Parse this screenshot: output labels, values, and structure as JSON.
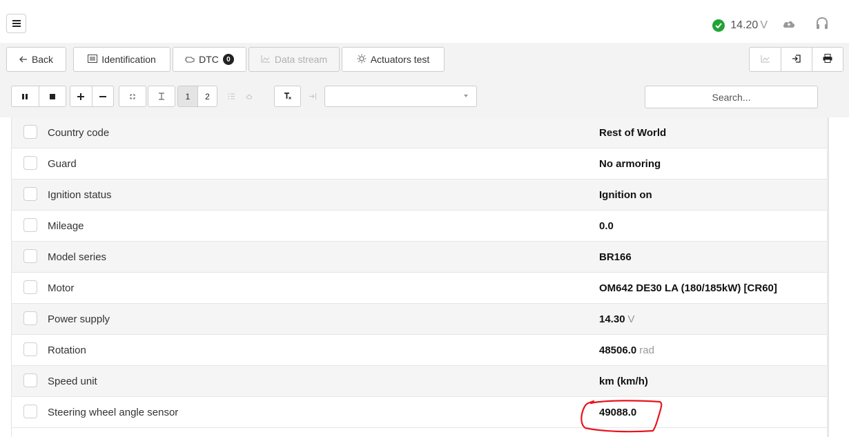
{
  "status": {
    "voltage": "14.20",
    "voltage_unit": "V",
    "ok_color": "#21a336",
    "icons": [
      "check-circle-icon",
      "cloud-icon",
      "headset-icon"
    ]
  },
  "nav": {
    "back_label": "Back",
    "identification_label": "Identification",
    "dtc_label": "DTC",
    "dtc_count": "0",
    "data_stream_label": "Data stream",
    "actuators_label": "Actuators test"
  },
  "toolbar": {
    "page_1": "1",
    "page_2": "2",
    "search_placeholder": "Search..."
  },
  "rows": [
    {
      "name": "Country code",
      "value": "Rest of World",
      "unit": ""
    },
    {
      "name": "Guard",
      "value": "No armoring",
      "unit": ""
    },
    {
      "name": "Ignition status",
      "value": "Ignition on",
      "unit": ""
    },
    {
      "name": "Mileage",
      "value": "0.0",
      "unit": ""
    },
    {
      "name": "Model series",
      "value": "BR166",
      "unit": ""
    },
    {
      "name": "Motor",
      "value": "OM642 DE30 LA (180/185kW) [CR60]",
      "unit": ""
    },
    {
      "name": "Power supply",
      "value": "14.30",
      "unit": "V"
    },
    {
      "name": "Rotation",
      "value": "48506.0",
      "unit": "rad"
    },
    {
      "name": "Speed unit",
      "value": "km (km/h)",
      "unit": ""
    },
    {
      "name": "Steering wheel angle sensor",
      "value": "49088.0",
      "unit": ""
    }
  ],
  "annotation_color": "#e8141e"
}
